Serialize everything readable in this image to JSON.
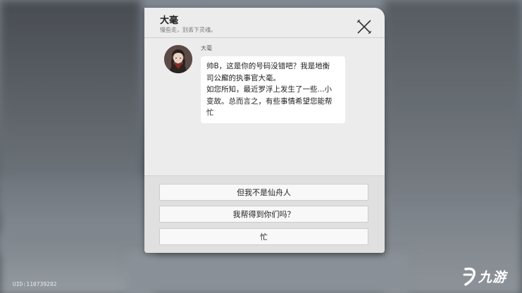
{
  "contact": {
    "name": "大毫",
    "signature": "慢些走，别丢下灵魂。"
  },
  "message": {
    "sender": "大毫",
    "lines": [
      "帅B，这是你的号码没错吧？我是地衡",
      "司公廨的执事官大毫。",
      "如您所知，最近罗浮上发生了一些...小",
      "变故。总而言之，有些事情希望您能帮",
      "忙"
    ]
  },
  "options": [
    "但我不是仙舟人",
    "我帮得到你们吗？",
    "忙"
  ],
  "footer": {
    "uid": "UID:110739202",
    "watermark": "九游"
  },
  "icons": {
    "close": "close-x-icon",
    "avatar": "character-portrait",
    "logo": "nine-game-logo-icon"
  }
}
